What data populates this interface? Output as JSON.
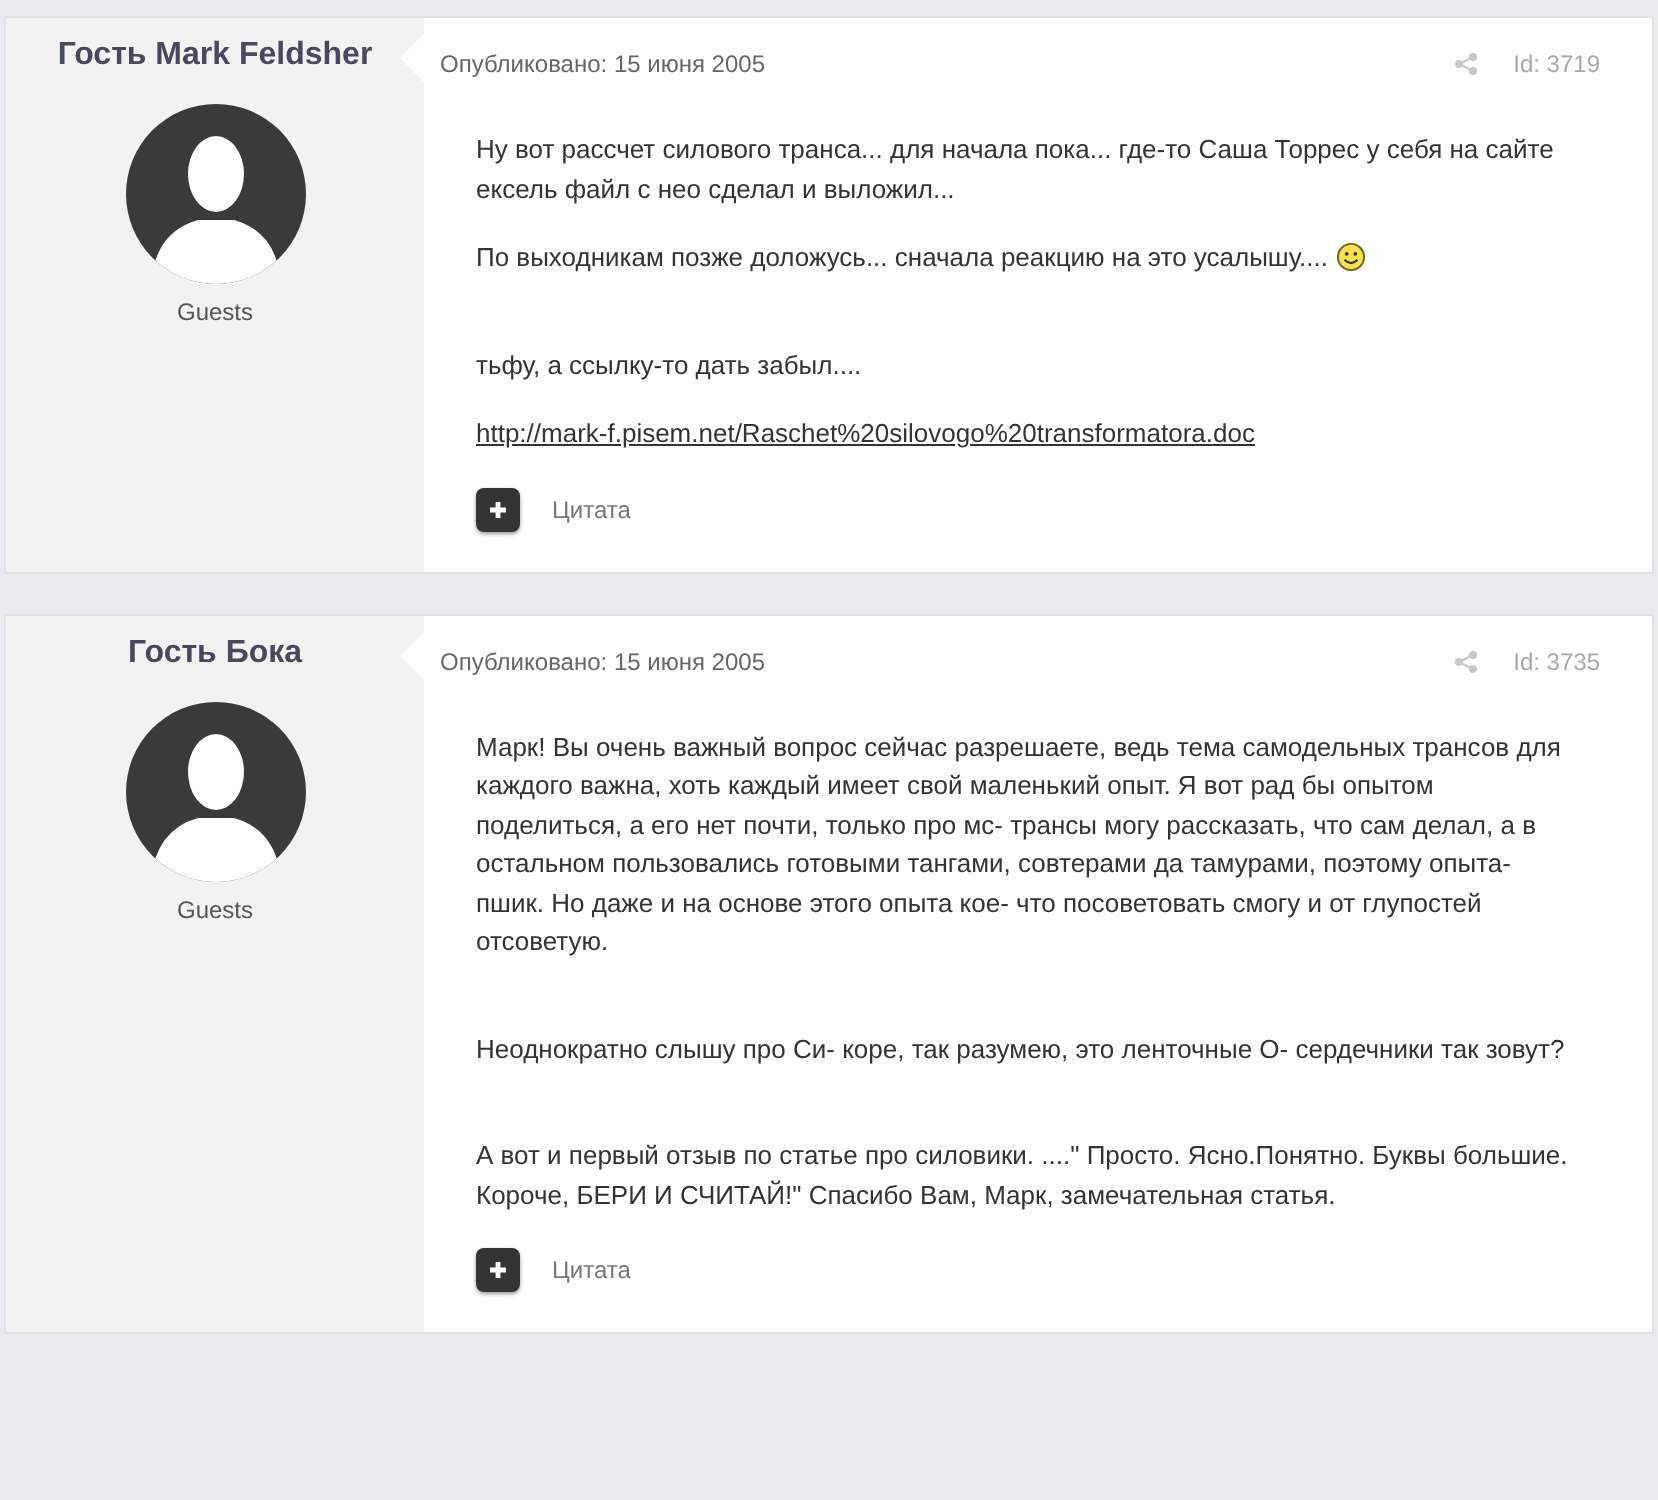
{
  "posts": [
    {
      "author": "Гость Mark Feldsher",
      "group": "Guests",
      "published": "Опубликовано: 15 июня 2005",
      "post_id": "Id: 3719",
      "blocks": [
        {
          "kind": "text",
          "text": "Ну вот рассчет силового транса... для начала пока... где-то Саша Торрес у себя на сайте ексель файл с нео сделал и выложил..."
        },
        {
          "kind": "text",
          "text": "По выходникам позже доложусь... сначала реакцию на это усалышу....",
          "emoticon": true
        },
        {
          "kind": "spacer"
        },
        {
          "kind": "text",
          "text": "тьфу, а ссылку-то дать забыл...."
        },
        {
          "kind": "link",
          "text": "http://mark-f.pisem.net/Raschet%20silovogo%20transformatora.doc"
        }
      ],
      "quote_label": "Цитата"
    },
    {
      "author": "Гость Бока",
      "group": "Guests",
      "published": "Опубликовано: 15 июня 2005",
      "post_id": "Id: 3735",
      "blocks": [
        {
          "kind": "text",
          "text": "Марк! Вы очень важный вопрос сейчас разрешаете, ведь тема самодельных трансов для каждого важна, хоть каждый имеет свой маленький опыт. Я вот рад бы опытом поделиться, а его нет почти, только про мс- трансы могу рассказать, что сам делал, а в остальном пользовались готовыми тангами, совтерами да тамурами, поэтому опыта- пшик. Но даже и на основе этого опыта кое- что посоветовать смогу и от глупостей отсоветую."
        },
        {
          "kind": "spacer"
        },
        {
          "kind": "text",
          "text": "Неоднократно слышу про Си- коре, так разумею, это ленточные О- сердечники так зовут?"
        },
        {
          "kind": "spacer"
        },
        {
          "kind": "text",
          "text": "А вот и первый отзыв по статье про силовики. ....\" Просто. Ясно.Понятно. Буквы большие. Короче, БЕРИ И СЧИТАЙ!\" Спасибо Вам, Марк, замечательная статья."
        }
      ],
      "quote_label": "Цитата"
    }
  ]
}
